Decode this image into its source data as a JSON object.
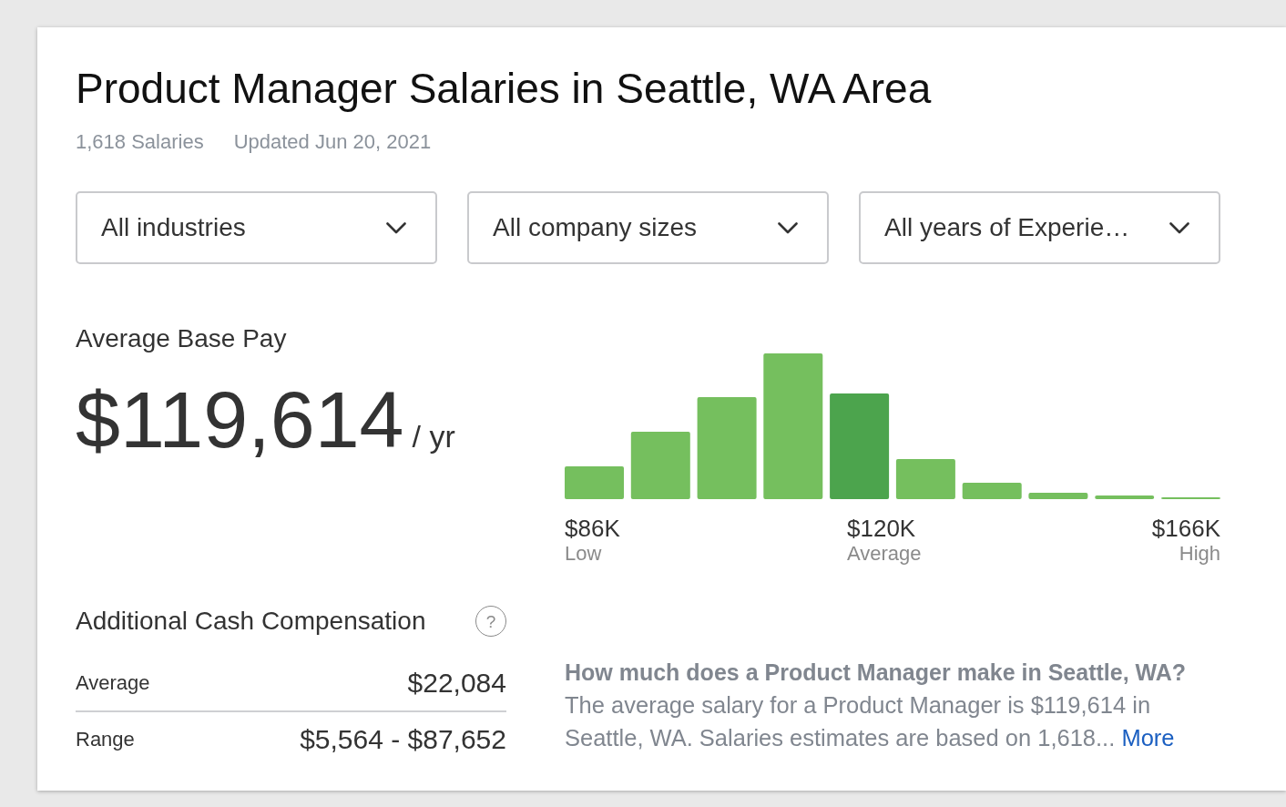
{
  "title": "Product Manager Salaries in Seattle, WA Area",
  "meta": {
    "salary_count": "1,618 Salaries",
    "updated": "Updated Jun 20, 2021"
  },
  "filters": [
    {
      "label": "All industries"
    },
    {
      "label": "All company sizes"
    },
    {
      "label": "All years of Experie…"
    }
  ],
  "base_pay": {
    "heading": "Average Base Pay",
    "amount": "$119,614",
    "unit": "/ yr"
  },
  "distribution": {
    "low": {
      "value": "$86K",
      "label": "Low"
    },
    "average": {
      "value": "$120K",
      "label": "Average"
    },
    "high": {
      "value": "$166K",
      "label": "High"
    }
  },
  "additional_cash": {
    "heading": "Additional Cash Compensation",
    "help_icon": "?",
    "rows": [
      {
        "label": "Average",
        "value": "$22,084"
      },
      {
        "label": "Range",
        "value": "$5,564 - $87,652"
      }
    ]
  },
  "faq": {
    "question": "How much does a Product Manager make in Seattle, WA?",
    "answer": "The average salary for a Product Manager is $119,614 in Seattle, WA. Salaries estimates are based on 1,618...",
    "link": "More"
  }
}
